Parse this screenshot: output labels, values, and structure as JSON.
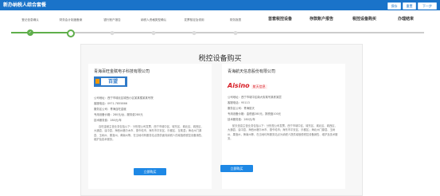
{
  "header": {
    "title": "新办纳税人综合套餐",
    "buttons": [
      "保存",
      "重置",
      "下一步"
    ]
  },
  "steps": [
    {
      "label": "登记信息确认",
      "state": "done",
      "icon": "check-icon"
    },
    {
      "label": "财务会计制度备案",
      "state": "current",
      "icon": "check-icon"
    },
    {
      "label": "银行账户报告",
      "state": "todo"
    },
    {
      "label": "纳税人资格类型确认",
      "state": "todo"
    },
    {
      "label": "发票核定及领用",
      "state": "todo"
    },
    {
      "label": "财务报表",
      "state": "todo"
    },
    {
      "label": "首套税控设备",
      "state": "future"
    },
    {
      "label": "存款账户报告",
      "state": "future"
    },
    {
      "label": "税控设备购买",
      "state": "future"
    },
    {
      "label": "办理结束",
      "state": "future"
    }
  ],
  "page_title": "税控设备购买",
  "cards": [
    {
      "company": "青海百旺金赋电子科技有限公司",
      "logo_text": "百望",
      "fields": [
        "公司地址：西宁市城北区城西小区某某楼某某号院",
        "客服电话：0971-7855866",
        "服务区公司：青海百旺金赋",
        "专用设备价格：280元/台，服务费280元",
        "技术服务费：280元/年"
      ],
      "description": "百旺金赋主营业务包括以下：分别是公司发票、西宁市城中区、城东区、城北区、城西区、大通县、湟中县，海西州格尔木市、德令哈市，海东市平安区、乐都区、互助县；海北州门源县、玉树州、果洛州、黄南州等，在当地均有服务站点提供面向纳税人的增值税税控设备销售、维护及技术服务。",
      "buy_label": "立即购买"
    },
    {
      "company": "青海航天信息股份有限公司",
      "logo_text": "Aisino",
      "logo_sub": "航天信息",
      "fields": [
        "公司地址：西宁市城中区南大街某号某栋某层",
        "客服电话：95113",
        "服务区公司：青海航天",
        "专用设备价格：金税盘280元，报税盘100元",
        "技术服务费：280元/年"
      ],
      "description": "航天信息主营业务包括以下：分别是公司发票，西宁市城中区、城东区、城北区、城西区、大通县、湟中县，海西州格尔木市、德令哈市；海东市平安区、乐都区；海北州门源县、玉树州、果洛州，黄南州等，在当地均有服务站点为纳税人提供增值税税控设备销售、维护及技术服务。",
      "buy_label": "立即购买"
    }
  ],
  "colors": {
    "header": "#1a73c9",
    "done": "#5fae4b",
    "button": "#1e88e5"
  }
}
